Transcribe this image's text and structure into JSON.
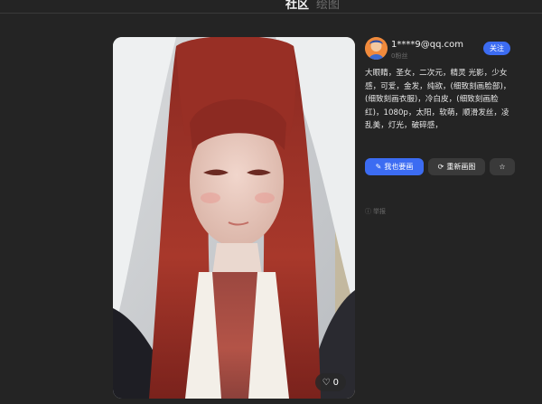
{
  "tabs": [
    {
      "label": "社区"
    },
    {
      "label": "绘图"
    }
  ],
  "user": {
    "name": "1****9@qq.com",
    "meta": "0粉丝",
    "follow_label": "关注"
  },
  "prompt": "大眼睛，圣女，二次元，精灵 光影，少女感，可爱，金发，纯欲，(细致刻画脸部)，(细致刻画衣服)，冷白皮，(细致刻画脸红)，1080p，太阳，软萌，顺滑发丝，凌乱美，灯光，破碎感，",
  "actions": {
    "make_same": "我也要画",
    "redraw": "重新画图"
  },
  "likes": "0",
  "report_label": "举报",
  "colors": {
    "accent": "#3c6cf2",
    "background": "#242424",
    "button_dark": "#3a3a3a"
  },
  "icons": [
    "edit-icon",
    "refresh-icon",
    "star-icon",
    "heart-icon",
    "info-icon"
  ]
}
